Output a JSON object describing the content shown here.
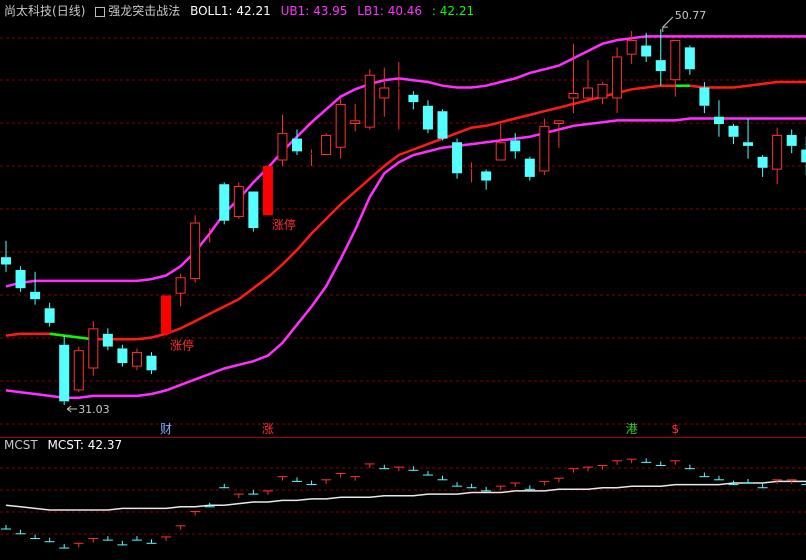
{
  "header": {
    "stock_name": "尚太科技",
    "period": "(日线)",
    "indicator_name": "强龙突击战法",
    "boll_label": "BOLL1: 42.21",
    "ub_label": "UB1: 43.95",
    "lb_label": "LB1: 40.46",
    "extra_label": ": 42.21"
  },
  "sub_header": {
    "name": "MCST",
    "value_label": "MCST: 42.37"
  },
  "colors": {
    "up": "#ff3030",
    "down": "#54ffff",
    "limit_up": "#ff0000",
    "mid_line": "#ff1a1a",
    "band_line": "#ff30ff",
    "mcst_line": "#e8e8e8",
    "grid": "#8b0000",
    "divider": "#aa0000",
    "green": "#00ff00",
    "annotation": "#c8c8c8"
  },
  "chart_data": {
    "type": "candlestick",
    "ylim": [
      29.5,
      52.3
    ],
    "candles": [
      {
        "o": 39.3,
        "h": 40.2,
        "l": 38.5,
        "c": 38.9
      },
      {
        "o": 38.6,
        "h": 38.8,
        "l": 37.4,
        "c": 37.6
      },
      {
        "o": 37.4,
        "h": 38.5,
        "l": 36.7,
        "c": 37.0
      },
      {
        "o": 36.5,
        "h": 36.8,
        "l": 35.5,
        "c": 35.7
      },
      {
        "o": 34.5,
        "h": 35.0,
        "l": 31.2,
        "c": 31.4
      },
      {
        "o": 32.0,
        "h": 34.4,
        "l": 31.9,
        "c": 34.2
      },
      {
        "o": 33.2,
        "h": 35.8,
        "l": 32.8,
        "c": 35.4
      },
      {
        "o": 35.1,
        "h": 35.4,
        "l": 34.2,
        "c": 34.4
      },
      {
        "o": 34.3,
        "h": 34.5,
        "l": 33.3,
        "c": 33.5
      },
      {
        "o": 33.3,
        "h": 34.3,
        "l": 33.1,
        "c": 34.1
      },
      {
        "o": 33.9,
        "h": 34.1,
        "l": 32.9,
        "c": 33.1
      },
      {
        "o": 35.1,
        "h": 37.2,
        "l": 35.0,
        "c": 37.2,
        "limit": true,
        "tag": "涨停"
      },
      {
        "o": 37.3,
        "h": 38.4,
        "l": 36.6,
        "c": 38.2
      },
      {
        "o": 38.1,
        "h": 41.6,
        "l": 37.9,
        "c": 41.2
      },
      {
        "o": 40.6,
        "h": 40.9,
        "l": 40.1,
        "c": 40.6
      },
      {
        "o": 43.3,
        "h": 43.4,
        "l": 41.1,
        "c": 41.3
      },
      {
        "o": 41.5,
        "h": 43.4,
        "l": 41.4,
        "c": 43.2
      },
      {
        "o": 42.9,
        "h": 42.9,
        "l": 40.7,
        "c": 40.9
      },
      {
        "o": 41.6,
        "h": 44.3,
        "l": 41.6,
        "c": 44.3,
        "limit": true,
        "tag": "涨停"
      },
      {
        "o": 44.6,
        "h": 47.1,
        "l": 44.3,
        "c": 46.1
      },
      {
        "o": 45.8,
        "h": 46.3,
        "l": 44.9,
        "c": 45.1
      },
      {
        "o": 45.0,
        "h": 45.2,
        "l": 44.3,
        "c": 45.0
      },
      {
        "o": 44.9,
        "h": 46.1,
        "l": 44.9,
        "c": 46.0
      },
      {
        "o": 45.3,
        "h": 48.0,
        "l": 44.7,
        "c": 47.7
      },
      {
        "o": 46.6,
        "h": 47.7,
        "l": 46.2,
        "c": 46.8
      },
      {
        "o": 46.4,
        "h": 49.6,
        "l": 46.3,
        "c": 49.3
      },
      {
        "o": 48.0,
        "h": 49.7,
        "l": 47.0,
        "c": 48.6
      },
      {
        "o": 48.6,
        "h": 50.0,
        "l": 46.3,
        "c": 48.6
      },
      {
        "o": 48.2,
        "h": 48.4,
        "l": 47.4,
        "c": 47.8
      },
      {
        "o": 47.6,
        "h": 47.9,
        "l": 46.1,
        "c": 46.3
      },
      {
        "o": 47.3,
        "h": 47.4,
        "l": 45.7,
        "c": 45.8
      },
      {
        "o": 45.6,
        "h": 45.8,
        "l": 43.6,
        "c": 43.9
      },
      {
        "o": 44.2,
        "h": 44.5,
        "l": 43.4,
        "c": 44.2
      },
      {
        "o": 44.0,
        "h": 44.1,
        "l": 43.0,
        "c": 43.5
      },
      {
        "o": 44.6,
        "h": 46.6,
        "l": 44.6,
        "c": 45.6
      },
      {
        "o": 45.7,
        "h": 46.1,
        "l": 44.7,
        "c": 45.1
      },
      {
        "o": 44.7,
        "h": 44.8,
        "l": 43.5,
        "c": 43.7
      },
      {
        "o": 44.0,
        "h": 46.9,
        "l": 43.8,
        "c": 46.5
      },
      {
        "o": 46.6,
        "h": 46.7,
        "l": 45.3,
        "c": 46.8
      },
      {
        "o": 48.0,
        "h": 51.0,
        "l": 47.2,
        "c": 48.3
      },
      {
        "o": 48.0,
        "h": 50.1,
        "l": 47.9,
        "c": 48.6
      },
      {
        "o": 48.0,
        "h": 48.9,
        "l": 47.7,
        "c": 48.8
      },
      {
        "o": 48.0,
        "h": 50.8,
        "l": 47.2,
        "c": 50.3
      },
      {
        "o": 50.4,
        "h": 51.7,
        "l": 49.9,
        "c": 51.2
      },
      {
        "o": 50.9,
        "h": 51.6,
        "l": 50.0,
        "c": 50.3
      },
      {
        "o": 50.1,
        "h": 51.8,
        "l": 48.7,
        "c": 49.5
      },
      {
        "o": 49.0,
        "h": 50.7,
        "l": 48.1,
        "c": 51.2
      },
      {
        "o": 50.8,
        "h": 50.9,
        "l": 49.3,
        "c": 49.6
      },
      {
        "o": 48.6,
        "h": 48.9,
        "l": 47.2,
        "c": 47.6
      },
      {
        "o": 47.0,
        "h": 47.9,
        "l": 45.9,
        "c": 46.6
      },
      {
        "o": 46.5,
        "h": 46.6,
        "l": 45.5,
        "c": 45.9
      },
      {
        "o": 45.6,
        "h": 46.9,
        "l": 44.7,
        "c": 45.4
      },
      {
        "o": 44.8,
        "h": 44.9,
        "l": 43.7,
        "c": 44.2
      },
      {
        "o": 44.1,
        "h": 46.4,
        "l": 43.3,
        "c": 46.0
      },
      {
        "o": 46.0,
        "h": 46.3,
        "l": 45.0,
        "c": 45.4
      },
      {
        "o": 45.2,
        "h": 45.9,
        "l": 43.8,
        "c": 44.5
      }
    ],
    "boll": {
      "mid": [
        35.0,
        35.1,
        35.1,
        35.1,
        35.0,
        34.9,
        34.8,
        34.8,
        34.8,
        34.8,
        34.9,
        35.1,
        35.4,
        35.8,
        36.2,
        36.6,
        37.0,
        37.6,
        38.2,
        38.9,
        39.7,
        40.6,
        41.4,
        42.2,
        42.9,
        43.6,
        44.3,
        44.9,
        45.2,
        45.5,
        45.8,
        46.1,
        46.4,
        46.5,
        46.7,
        46.9,
        47.1,
        47.3,
        47.5,
        47.7,
        47.9,
        48.1,
        48.3,
        48.5,
        48.6,
        48.7,
        48.7,
        48.7,
        48.6,
        48.6,
        48.6,
        48.7,
        48.8,
        48.9,
        48.9,
        48.9
      ],
      "ub": [
        37.7,
        37.9,
        38.0,
        38.0,
        38.0,
        38.0,
        38.0,
        38.0,
        38.0,
        38.0,
        38.1,
        38.3,
        38.8,
        39.6,
        40.6,
        41.7,
        42.5,
        43.4,
        44.2,
        45.1,
        45.9,
        46.7,
        47.4,
        48.1,
        48.5,
        48.8,
        49.0,
        49.1,
        49.0,
        48.9,
        48.7,
        48.6,
        48.6,
        48.7,
        48.9,
        49.1,
        49.4,
        49.6,
        49.8,
        50.2,
        50.6,
        51.0,
        51.2,
        51.3,
        51.4,
        51.4,
        51.4,
        51.4,
        51.4,
        51.4,
        51.4,
        51.4,
        51.4,
        51.4,
        51.4,
        51.4
      ],
      "lb": [
        32.0,
        31.9,
        31.8,
        31.7,
        31.6,
        31.6,
        31.7,
        31.7,
        31.7,
        31.7,
        31.8,
        32.0,
        32.3,
        32.6,
        32.9,
        33.2,
        33.4,
        33.6,
        33.9,
        34.6,
        35.6,
        36.6,
        37.7,
        39.2,
        40.8,
        42.6,
        43.9,
        44.5,
        44.9,
        45.1,
        45.3,
        45.4,
        45.5,
        45.6,
        45.7,
        45.8,
        45.9,
        46.1,
        46.3,
        46.5,
        46.6,
        46.7,
        46.8,
        46.8,
        46.8,
        46.8,
        46.8,
        46.9,
        46.9,
        46.9,
        46.9,
        46.9,
        46.9,
        46.9,
        46.9,
        46.9
      ],
      "green_segments": [
        [
          3,
          6
        ],
        [
          46,
          47
        ]
      ]
    },
    "annotations": {
      "high_label": "50.77",
      "high_index": 45,
      "low_label": "31.03",
      "low_index": 4
    },
    "markers": [
      {
        "index": 11,
        "text": "财",
        "color": "#7fb0ff"
      },
      {
        "index": 18,
        "text": "涨",
        "color": "#ff3030"
      },
      {
        "index": 43,
        "text": "港",
        "color": "#33cc33"
      },
      {
        "index": 46,
        "text": "$",
        "color": "#ff3030"
      }
    ],
    "mcst": {
      "name": "MCST",
      "value": 42.37,
      "ylim": [
        37.5,
        43.8
      ],
      "line": [
        40.7,
        40.6,
        40.5,
        40.4,
        40.4,
        40.4,
        40.4,
        40.4,
        40.5,
        40.5,
        40.5,
        40.5,
        40.6,
        40.6,
        40.7,
        40.7,
        40.8,
        40.9,
        40.9,
        41.0,
        41.0,
        41.1,
        41.1,
        41.2,
        41.2,
        41.2,
        41.3,
        41.3,
        41.3,
        41.4,
        41.4,
        41.4,
        41.5,
        41.5,
        41.5,
        41.6,
        41.6,
        41.6,
        41.7,
        41.7,
        41.7,
        41.8,
        41.8,
        41.9,
        41.9,
        41.9,
        42.0,
        42.0,
        42.0,
        42.0,
        42.1,
        42.1,
        42.1,
        42.2,
        42.2,
        42.2
      ],
      "marks": [
        {
          "v": 39.2,
          "up": false
        },
        {
          "v": 38.9,
          "up": false
        },
        {
          "v": 38.6,
          "up": false
        },
        {
          "v": 38.4,
          "up": false
        },
        {
          "v": 38.0,
          "up": false
        },
        {
          "v": 38.3,
          "up": true
        },
        {
          "v": 38.6,
          "up": true
        },
        {
          "v": 38.5,
          "up": false
        },
        {
          "v": 38.2,
          "up": false
        },
        {
          "v": 38.5,
          "up": false
        },
        {
          "v": 38.3,
          "up": false
        },
        {
          "v": 38.7,
          "up": true
        },
        {
          "v": 39.4,
          "up": true
        },
        {
          "v": 40.3,
          "up": true
        },
        {
          "v": 40.6,
          "up": false
        },
        {
          "v": 41.8,
          "up": false
        },
        {
          "v": 41.4,
          "up": true
        },
        {
          "v": 41.4,
          "up": false
        },
        {
          "v": 41.6,
          "up": true
        },
        {
          "v": 42.5,
          "up": true
        },
        {
          "v": 42.2,
          "up": false
        },
        {
          "v": 42.0,
          "up": false
        },
        {
          "v": 42.3,
          "up": true
        },
        {
          "v": 42.7,
          "up": true
        },
        {
          "v": 42.5,
          "up": true
        },
        {
          "v": 43.3,
          "up": true
        },
        {
          "v": 43.0,
          "up": false
        },
        {
          "v": 43.1,
          "up": true
        },
        {
          "v": 42.9,
          "up": false
        },
        {
          "v": 42.6,
          "up": false
        },
        {
          "v": 42.3,
          "up": false
        },
        {
          "v": 41.9,
          "up": false
        },
        {
          "v": 41.8,
          "up": false
        },
        {
          "v": 41.6,
          "up": false
        },
        {
          "v": 41.9,
          "up": true
        },
        {
          "v": 42.1,
          "up": true
        },
        {
          "v": 41.7,
          "up": false
        },
        {
          "v": 42.2,
          "up": true
        },
        {
          "v": 42.4,
          "up": true
        },
        {
          "v": 43.0,
          "up": true
        },
        {
          "v": 43.1,
          "up": true
        },
        {
          "v": 43.2,
          "up": true
        },
        {
          "v": 43.5,
          "up": true
        },
        {
          "v": 43.6,
          "up": true
        },
        {
          "v": 43.4,
          "up": false
        },
        {
          "v": 43.2,
          "up": false
        },
        {
          "v": 43.5,
          "up": true
        },
        {
          "v": 43.0,
          "up": false
        },
        {
          "v": 42.5,
          "up": false
        },
        {
          "v": 42.3,
          "up": false
        },
        {
          "v": 42.0,
          "up": false
        },
        {
          "v": 42.1,
          "up": false
        },
        {
          "v": 41.8,
          "up": false
        },
        {
          "v": 42.3,
          "up": true
        },
        {
          "v": 42.3,
          "up": true
        },
        {
          "v": 42.0,
          "up": false
        }
      ]
    }
  }
}
